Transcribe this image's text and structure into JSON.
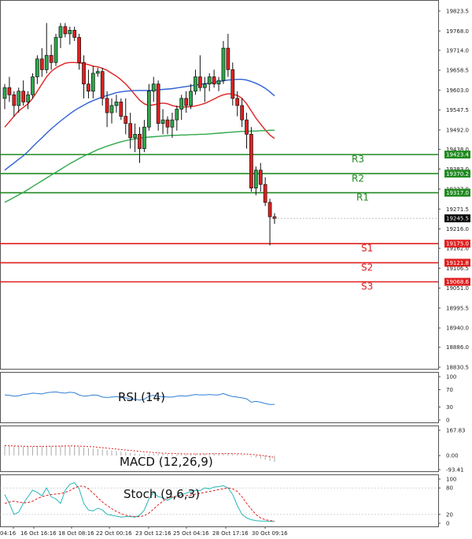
{
  "chart_data": {
    "type": "candlestick",
    "price_axis": {
      "ticks": [
        19823.5,
        19768.0,
        19714.0,
        19658.5,
        19603.0,
        19547.5,
        19492.0,
        19438.0,
        19383.0,
        19327.0,
        19271.5,
        19216.0,
        19162.0,
        19106.5,
        19051.0,
        18995.5,
        18940.0,
        18886.0,
        18830.5
      ],
      "tick_labels": [
        "19823.5",
        "19768.0",
        "19714.0",
        "19658.5",
        "19603.0",
        "19547.5",
        "19492.0",
        "19438.0",
        "19383.0",
        "19327.0",
        "19271.5",
        "19216.0",
        "19162.0",
        "19106.5",
        "19051.0",
        "18995.5",
        "18940.0",
        "18886.0",
        "18830.5"
      ],
      "range": [
        18830.5,
        19823.5
      ]
    },
    "time_axis": {
      "labels": [
        "04:16",
        "16 Oct 16:16",
        "18 Oct 08:16",
        "22 Oct 00:16",
        "23 Oct 12:16",
        "25 Oct 04:16",
        "28 Oct 17:16",
        "30 Oct 09:16"
      ]
    },
    "current_price": {
      "value": 19245.5,
      "label": "19245.5",
      "color": "#000000"
    },
    "levels": [
      {
        "name": "R3",
        "value": 19423.4,
        "label": "19423.4",
        "color": "#1f8a1f"
      },
      {
        "name": "R2",
        "value": 19370.2,
        "label": "19370.2",
        "color": "#1f8a1f"
      },
      {
        "name": "R1",
        "value": 19317.0,
        "label": "19317.0",
        "color": "#1f8a1f"
      },
      {
        "name": "S1",
        "value": 19175.0,
        "label": "19175.0",
        "color": "#e02020"
      },
      {
        "name": "S2",
        "value": 19121.8,
        "label": "19121.8",
        "color": "#e02020"
      },
      {
        "name": "S3",
        "value": 19068.6,
        "label": "19068.6",
        "color": "#e02020"
      }
    ],
    "candles": [
      [
        19580,
        19620,
        19550,
        19610
      ],
      [
        19610,
        19640,
        19570,
        19590
      ],
      [
        19590,
        19600,
        19530,
        19560
      ],
      [
        19560,
        19610,
        19540,
        19600
      ],
      [
        19600,
        19630,
        19560,
        19570
      ],
      [
        19570,
        19600,
        19550,
        19590
      ],
      [
        19590,
        19650,
        19580,
        19640
      ],
      [
        19640,
        19700,
        19620,
        19690
      ],
      [
        19690,
        19720,
        19640,
        19660
      ],
      [
        19660,
        19790,
        19650,
        19700
      ],
      [
        19700,
        19730,
        19660,
        19680
      ],
      [
        19680,
        19760,
        19670,
        19750
      ],
      [
        19750,
        19790,
        19720,
        19780
      ],
      [
        19780,
        19790,
        19750,
        19760
      ],
      [
        19760,
        19780,
        19730,
        19770
      ],
      [
        19770,
        19780,
        19740,
        19750
      ],
      [
        19750,
        19760,
        19660,
        19680
      ],
      [
        19680,
        19700,
        19580,
        19620
      ],
      [
        19620,
        19660,
        19580,
        19600
      ],
      [
        19600,
        19670,
        19580,
        19650
      ],
      [
        19650,
        19665,
        19640,
        19655
      ],
      [
        19655,
        19665,
        19560,
        19580
      ],
      [
        19580,
        19600,
        19500,
        19540
      ],
      [
        19540,
        19580,
        19510,
        19560
      ],
      [
        19560,
        19590,
        19540,
        19570
      ],
      [
        19570,
        19580,
        19520,
        19530
      ],
      [
        19530,
        19580,
        19480,
        19510
      ],
      [
        19510,
        19540,
        19440,
        19470
      ],
      [
        19470,
        19510,
        19430,
        19480
      ],
      [
        19480,
        19500,
        19400,
        19440
      ],
      [
        19440,
        19520,
        19430,
        19500
      ],
      [
        19500,
        19620,
        19490,
        19600
      ],
      [
        19600,
        19640,
        19570,
        19620
      ],
      [
        19620,
        19630,
        19490,
        19510
      ],
      [
        19510,
        19550,
        19480,
        19520
      ],
      [
        19520,
        19530,
        19480,
        19500
      ],
      [
        19500,
        19540,
        19470,
        19520
      ],
      [
        19520,
        19560,
        19490,
        19550
      ],
      [
        19550,
        19590,
        19520,
        19580
      ],
      [
        19580,
        19600,
        19540,
        19560
      ],
      [
        19560,
        19620,
        19550,
        19600
      ],
      [
        19600,
        19660,
        19590,
        19640
      ],
      [
        19640,
        19700,
        19600,
        19610
      ],
      [
        19610,
        19640,
        19570,
        19620
      ],
      [
        19620,
        19650,
        19600,
        19640
      ],
      [
        19640,
        19660,
        19610,
        19620
      ],
      [
        19620,
        19640,
        19600,
        19630
      ],
      [
        19630,
        19740,
        19620,
        19720
      ],
      [
        19720,
        19760,
        19640,
        19660
      ],
      [
        19660,
        19680,
        19560,
        19580
      ],
      [
        19580,
        19600,
        19530,
        19560
      ],
      [
        19560,
        19580,
        19500,
        19520
      ],
      [
        19520,
        19540,
        19440,
        19480
      ],
      [
        19480,
        19500,
        19320,
        19330
      ],
      [
        19330,
        19390,
        19310,
        19380
      ],
      [
        19380,
        19400,
        19320,
        19340
      ],
      [
        19340,
        19360,
        19280,
        19290
      ],
      [
        19290,
        19300,
        19170,
        19250
      ],
      [
        19250,
        19260,
        19230,
        19245
      ]
    ],
    "moving_averages": [
      {
        "name": "",
        "color": "#e02020",
        "values": [
          19500,
          19515,
          19530,
          19545,
          19555,
          19565,
          19580,
          19600,
          19620,
          19640,
          19655,
          19665,
          19672,
          19678,
          19680,
          19680,
          19679,
          19677,
          19674,
          19670,
          19668,
          19664,
          19658,
          19650,
          19642,
          19632,
          19620,
          19606,
          19590,
          19575,
          19565,
          19560,
          19562,
          19565,
          19567,
          19565,
          19560,
          19557,
          19556,
          19556,
          19557,
          19559,
          19562,
          19566,
          19572,
          19578,
          19585,
          19590,
          19593,
          19592,
          19588,
          19580,
          19565,
          19545,
          19525,
          19508,
          19492,
          19478,
          19468
        ]
      },
      {
        "name": "",
        "color": "#2f5fd6",
        "values": [
          19380,
          19390,
          19400,
          19410,
          19420,
          19432,
          19445,
          19458,
          19470,
          19483,
          19495,
          19506,
          19517,
          19527,
          19537,
          19546,
          19554,
          19561,
          19568,
          19574,
          19579,
          19584,
          19588,
          19592,
          19596,
          19598,
          19600,
          19601,
          19602,
          19602,
          19602,
          19602,
          19603,
          19604,
          19605,
          19606,
          19607,
          19609,
          19611,
          19613,
          19615,
          19617,
          19619,
          19621,
          19623,
          19625,
          19627,
          19629,
          19631,
          19632,
          19633,
          19633,
          19631,
          19627,
          19622,
          19616,
          19608,
          19598,
          19587
        ]
      },
      {
        "name": "",
        "color": "#2ea84a",
        "values": [
          19290,
          19297,
          19304,
          19311,
          19318,
          19326,
          19334,
          19342,
          19350,
          19358,
          19366,
          19374,
          19382,
          19390,
          19398,
          19405,
          19412,
          19419,
          19425,
          19431,
          19437,
          19442,
          19447,
          19451,
          19455,
          19459,
          19462,
          19465,
          19467,
          19469,
          19471,
          19472,
          19473,
          19474,
          19475,
          19476,
          19477,
          19477,
          19478,
          19478,
          19479,
          19479,
          19480,
          19480,
          19481,
          19482,
          19483,
          19484,
          19485,
          19486,
          19487,
          19488,
          19488,
          19489,
          19489,
          19490,
          19490,
          19491,
          19491
        ]
      }
    ]
  },
  "indicators": {
    "rsi": {
      "name": "RSI (14)",
      "ticks": [
        100,
        70,
        30,
        0
      ],
      "tick_labels": [
        "100",
        "70",
        "30",
        "0"
      ],
      "values": [
        58,
        57,
        55,
        56,
        59,
        60,
        62,
        61,
        60,
        63,
        64,
        65,
        63,
        62,
        64,
        63,
        58,
        55,
        56,
        58,
        57,
        53,
        52,
        53,
        54,
        52,
        51,
        49,
        48,
        46,
        48,
        55,
        57,
        54,
        54,
        53,
        53,
        55,
        56,
        55,
        57,
        59,
        58,
        58,
        59,
        58,
        58,
        61,
        57,
        54,
        53,
        51,
        49,
        41,
        43,
        41,
        38,
        36,
        36
      ]
    },
    "macd": {
      "name": "MACD (12,26,9)",
      "ticks": [
        167.83,
        0.0,
        -93.41
      ],
      "tick_labels": [
        "167.83",
        "0.00",
        "-93.41"
      ],
      "range": [
        -93.41,
        167.83
      ],
      "hist": [
        68,
        66,
        64,
        62,
        61,
        60,
        60,
        61,
        62,
        63,
        64,
        65,
        66,
        66,
        65,
        64,
        60,
        55,
        50,
        47,
        44,
        40,
        36,
        33,
        30,
        26,
        22,
        18,
        14,
        10,
        9,
        10,
        12,
        12,
        11,
        10,
        9,
        9,
        9,
        9,
        10,
        11,
        12,
        12,
        13,
        13,
        13,
        15,
        14,
        11,
        8,
        5,
        1,
        -8,
        -14,
        -20,
        -27,
        -36,
        -42
      ],
      "signal": [
        66,
        65,
        64,
        63,
        62,
        61,
        61,
        61,
        61,
        62,
        62,
        63,
        63,
        64,
        64,
        64,
        63,
        62,
        60,
        58,
        55,
        52,
        49,
        46,
        43,
        40,
        37,
        34,
        31,
        28,
        25,
        22,
        20,
        18,
        16,
        15,
        14,
        13,
        12,
        11,
        11,
        11,
        11,
        11,
        12,
        12,
        12,
        13,
        13,
        13,
        12,
        11,
        10,
        8,
        5,
        2,
        -2,
        -7,
        -12
      ]
    },
    "stoch": {
      "name": "Stoch (9,6,3)",
      "ticks": [
        100,
        80,
        20,
        0
      ],
      "tick_labels": [
        "100",
        "80",
        "20",
        "0"
      ],
      "k": [
        65,
        45,
        20,
        25,
        45,
        60,
        75,
        70,
        62,
        80,
        60,
        55,
        45,
        75,
        88,
        92,
        78,
        45,
        30,
        28,
        34,
        30,
        20,
        18,
        16,
        14,
        15,
        15,
        14,
        18,
        30,
        55,
        70,
        60,
        58,
        52,
        58,
        62,
        65,
        68,
        72,
        75,
        74,
        80,
        78,
        82,
        83,
        85,
        80,
        65,
        40,
        20,
        12,
        8,
        6,
        5,
        5,
        4,
        4
      ],
      "d": [
        45,
        48,
        50,
        48,
        46,
        47,
        50,
        56,
        60,
        63,
        65,
        66,
        67,
        70,
        74,
        80,
        84,
        84,
        78,
        68,
        58,
        48,
        40,
        33,
        27,
        22,
        18,
        16,
        15,
        15,
        17,
        23,
        32,
        42,
        50,
        57,
        60,
        61,
        62,
        63,
        64,
        66,
        68,
        70,
        72,
        74,
        76,
        78,
        80,
        78,
        72,
        60,
        45,
        32,
        20,
        12,
        8,
        6,
        5
      ]
    }
  }
}
